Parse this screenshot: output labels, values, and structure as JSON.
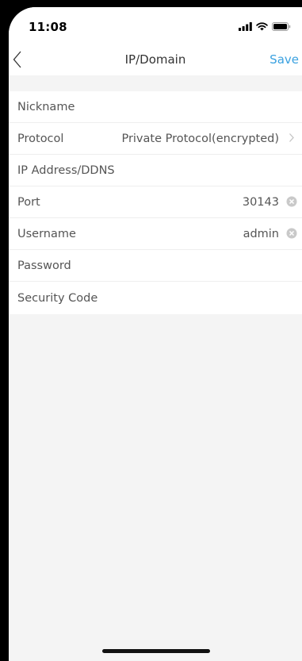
{
  "status_bar": {
    "time": "11:08",
    "icons": [
      "signal-icon",
      "wifi-icon",
      "battery-icon"
    ]
  },
  "nav": {
    "title": "IP/Domain",
    "save_label": "Save",
    "back_icon": "chevron-left-icon",
    "accent_color": "#3aa1e0"
  },
  "form": {
    "nickname": {
      "label": "Nickname",
      "value": ""
    },
    "protocol": {
      "label": "Protocol",
      "value": "Private Protocol(encrypted)",
      "icon": "chevron-right-icon"
    },
    "ip_address": {
      "label": "IP Address/DDNS",
      "value": ""
    },
    "port": {
      "label": "Port",
      "value": "30143",
      "icon": "clear-icon"
    },
    "username": {
      "label": "Username",
      "value": "admin",
      "icon": "clear-icon"
    },
    "password": {
      "label": "Password",
      "value": ""
    },
    "security_code": {
      "label": "Security Code",
      "value": ""
    }
  }
}
